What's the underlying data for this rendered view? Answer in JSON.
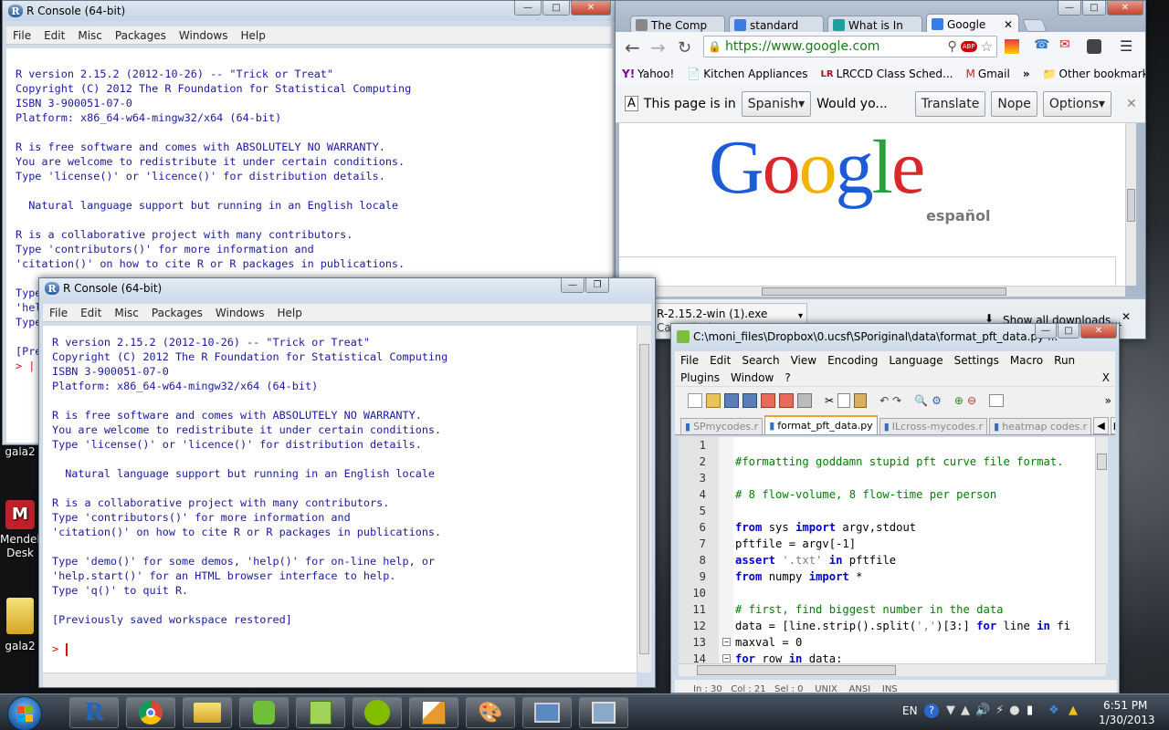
{
  "desktop": {
    "icons": [
      {
        "label": "gala2"
      },
      {
        "label": "Mendeley Desk"
      },
      {
        "label": "gala2"
      }
    ]
  },
  "r_back": {
    "title": "R Console (64-bit)",
    "menu": [
      "File",
      "Edit",
      "Misc",
      "Packages",
      "Windows",
      "Help"
    ],
    "lines": [
      "R version 2.15.2 (2012-10-26) -- \"Trick or Treat\"",
      "Copyright (C) 2012 The R Foundation for Statistical Computing",
      "ISBN 3-900051-07-0",
      "Platform: x86_64-w64-mingw32/x64 (64-bit)",
      "",
      "R is free software and comes with ABSOLUTELY NO WARRANTY.",
      "You are welcome to redistribute it under certain conditions.",
      "Type 'license()' or 'licence()' for distribution details.",
      "",
      "  Natural language support but running in an English locale",
      "",
      "R is a collaborative project with many contributors.",
      "Type 'contributors()' for more information and",
      "'citation()' on how to cite R or R packages in publications.",
      "",
      "Type",
      "'hel",
      "Type",
      "",
      "[Pre"
    ],
    "prompt": "> |"
  },
  "r_front": {
    "title": "R Console (64-bit)",
    "menu": [
      "File",
      "Edit",
      "Misc",
      "Packages",
      "Windows",
      "Help"
    ],
    "lines": [
      "R version 2.15.2 (2012-10-26) -- \"Trick or Treat\"",
      "Copyright (C) 2012 The R Foundation for Statistical Computing",
      "ISBN 3-900051-07-0",
      "Platform: x86_64-w64-mingw32/x64 (64-bit)",
      "",
      "R is free software and comes with ABSOLUTELY NO WARRANTY.",
      "You are welcome to redistribute it under certain conditions.",
      "Type 'license()' or 'licence()' for distribution details.",
      "",
      "  Natural language support but running in an English locale",
      "",
      "R is a collaborative project with many contributors.",
      "Type 'contributors()' for more information and",
      "'citation()' on how to cite R or R packages in publications.",
      "",
      "Type 'demo()' for some demos, 'help()' for on-line help, or",
      "'help.start()' for an HTML browser interface to help.",
      "Type 'q()' to quit R.",
      "",
      "[Previously saved workspace restored]",
      ""
    ],
    "prompt": ">"
  },
  "chrome": {
    "tabs": [
      {
        "label": "The Comp",
        "color": "#888888"
      },
      {
        "label": "standard",
        "color": "#3b7be3"
      },
      {
        "label": "What is In",
        "color": "#1aa39a"
      },
      {
        "label": "Google",
        "color": "#3b7be3"
      }
    ],
    "url": "https://www.google.com",
    "bookmarks": [
      {
        "label": "Yahoo!"
      },
      {
        "label": "Kitchen Appliances"
      },
      {
        "label": "LRCCD Class Sched..."
      },
      {
        "label": "Gmail"
      }
    ],
    "more_bookmarks": "»",
    "other_bookmarks": "Other bookmarks",
    "infobar": {
      "text": "This page is in",
      "language": "Spanish",
      "question": "Would yo...",
      "translate": "Translate",
      "nope": "Nope",
      "options": "Options"
    },
    "logo_sub": "español",
    "download": {
      "file": "R-2.15.2-win (1).exe",
      "status": "Cancelled",
      "show_all": "Show all downloads..."
    }
  },
  "npp": {
    "title": "C:\\moni_files\\Dropbox\\0.ucsf\\SPoriginal\\data\\format_pft_data.py ...",
    "menu1": [
      "File",
      "Edit",
      "Search",
      "View",
      "Encoding",
      "Language",
      "Settings",
      "Macro",
      "Run"
    ],
    "menu2": [
      "Plugins",
      "Window",
      "?"
    ],
    "menu_close": "X",
    "tabs": [
      "SPmycodes.r",
      "format_pft_data.py",
      "ILcross-mycodes.r",
      "heatmap codes.r"
    ],
    "line_numbers": [
      "1",
      "2",
      "3",
      "4",
      "5",
      "6",
      "7",
      "8",
      "9",
      "10",
      "11",
      "12",
      "13",
      "14"
    ],
    "status_partial": "In : 30   Col : 21   Sel : 0    UNIX    ANSI    INS"
  },
  "taskbar": {
    "lang": "EN",
    "time": "6:51 PM",
    "date": "1/30/2013"
  },
  "colors": {
    "r_text": "#1a1aa0",
    "prompt": "#d01010",
    "keyword": "#0000d0",
    "comment": "#008000"
  }
}
